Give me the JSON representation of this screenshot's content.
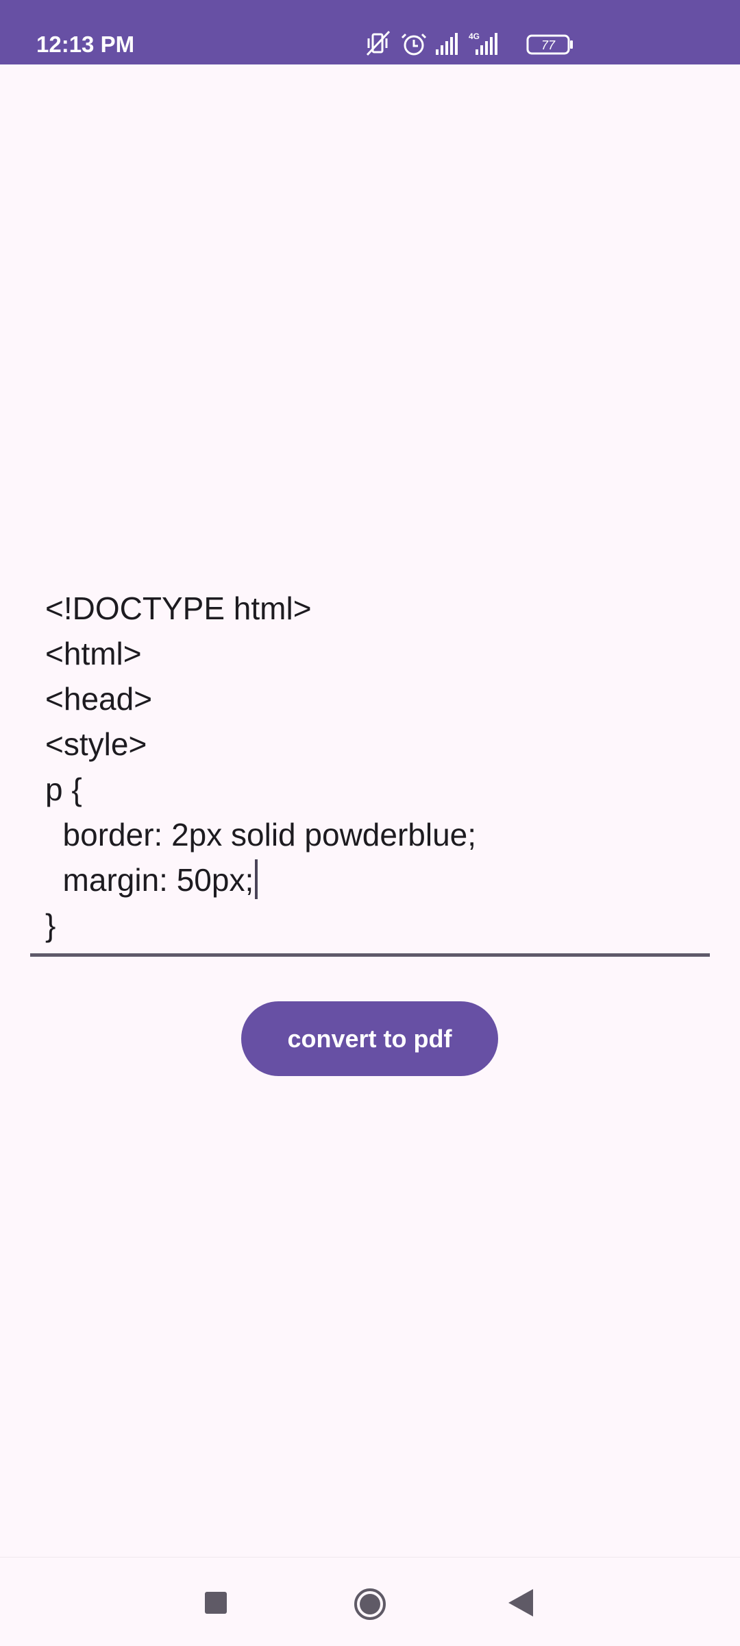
{
  "status_bar": {
    "time": "12:13 PM",
    "battery": "77",
    "network_type": "4G",
    "icons": [
      "vibrate-off-icon",
      "alarm-icon",
      "signal-icon",
      "signal-4g-icon",
      "battery-icon"
    ],
    "color": "#6750A4"
  },
  "editor": {
    "value": "<!DOCTYPE html>\n<html>\n<head>\n<style>\np {\n  border: 2px solid powderblue;\n  margin: 50px;\n}"
  },
  "convert_button": {
    "label": "convert to pdf",
    "color": "#6750A4"
  },
  "nav_bar": {
    "icons": [
      "recents-icon",
      "home-icon",
      "back-icon"
    ]
  },
  "colors": {
    "background": "#FEF7FC",
    "accent": "#6750A4",
    "text": "#1D1B20"
  }
}
